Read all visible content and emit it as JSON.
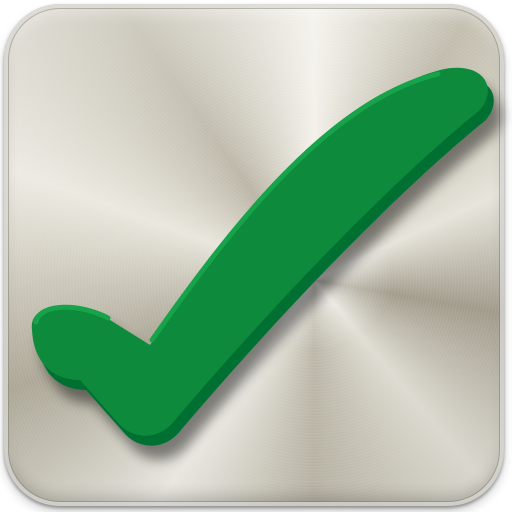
{
  "icon": {
    "name": "checkmark-icon",
    "colors": {
      "check_face": "#0b8a3a",
      "check_side": "#067030",
      "check_edge": "#13a34a",
      "metal_light": "#f3f1ea",
      "metal_dark": "#a9a392"
    }
  }
}
